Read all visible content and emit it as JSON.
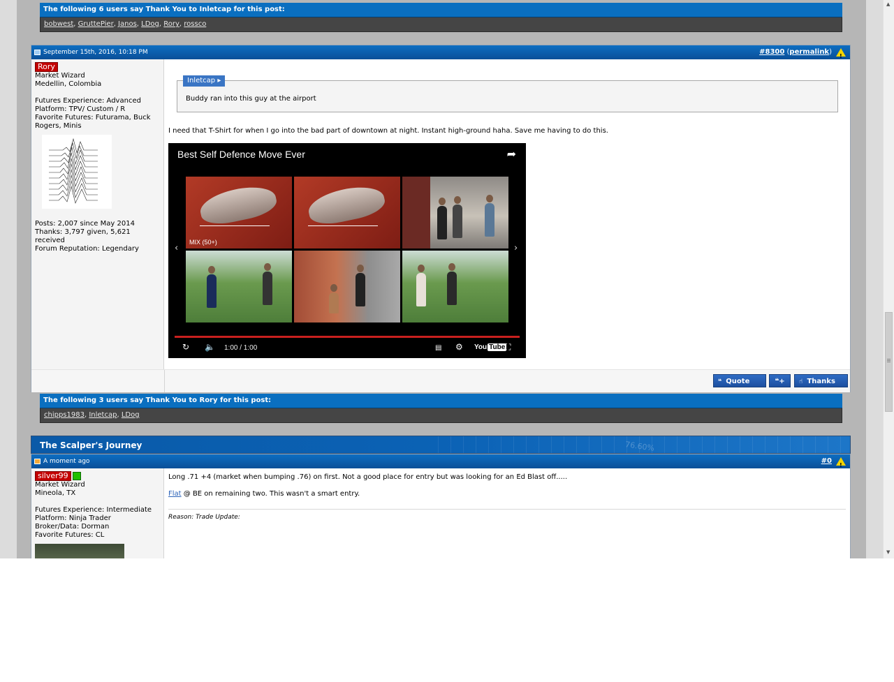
{
  "thanks_top": {
    "header": "The following 6 users say Thank You to Inletcap for this post:",
    "users": [
      "bobwest",
      "GruttePier",
      "Janos",
      "LDog",
      "Rory",
      "rossco"
    ]
  },
  "post1": {
    "date": "September 15th, 2016, 10:18 PM",
    "number": "#8300",
    "permalink": "permalink",
    "user": {
      "name": "Rory",
      "title": "Market Wizard",
      "location": "Medellin, Colombia",
      "experience": "Futures Experience: Advanced",
      "platform": "Platform: TPV/ Custom / R",
      "favorite": "Favorite Futures: Futurama, Buck Rogers, Minis",
      "posts": "Posts: 2,007 since May 2014",
      "thanks": "Thanks: 3,797 given, 5,621 received",
      "reputation": "Forum Reputation: Legendary"
    },
    "quote": {
      "author": "Inletcap",
      "text": "Buddy ran into this guy at the airport"
    },
    "message": "I need that T-Shirt for when I go into the bad part of downtown at night. Instant high-ground haha. Save me having to do this.",
    "video": {
      "title": "Best Self Defence Move Ever",
      "mix_label": "MIX (50+)",
      "timecode": "1:00 / 1:00",
      "logo": "You",
      "logo_tube": "Tube"
    },
    "buttons": {
      "quote": "Quote",
      "thanks": "Thanks"
    }
  },
  "thanks_bottom": {
    "header": "The following 3 users say Thank You to Rory for this post:",
    "users": [
      "chipps1983",
      "Inletcap",
      "LDog"
    ]
  },
  "journey": {
    "title": "The Scalper's Journey",
    "ghost": "76.60%"
  },
  "post2": {
    "date": "A moment ago",
    "number": "#0",
    "user": {
      "name": "silver99",
      "title": "Market Wizard",
      "location": "Mineola, TX",
      "experience": "Futures Experience: Intermediate",
      "platform": "Platform: Ninja Trader",
      "broker": "Broker/Data: Dorman",
      "favorite": "Favorite Futures: CL"
    },
    "line1": "Long .71 +4 (market when bumping .76) on first. Not a good place for entry but was looking for an Ed Blast off.....",
    "line2_link": "Flat",
    "line2_rest": " @ BE on remaining two. This wasn't a smart entry.",
    "reason": "Reason: Trade Update:"
  },
  "colors": {
    "header_blue": "#0a6fc0",
    "username_red": "#c30000",
    "online_green": "#1fc000",
    "progress_red": "#c8201e"
  }
}
